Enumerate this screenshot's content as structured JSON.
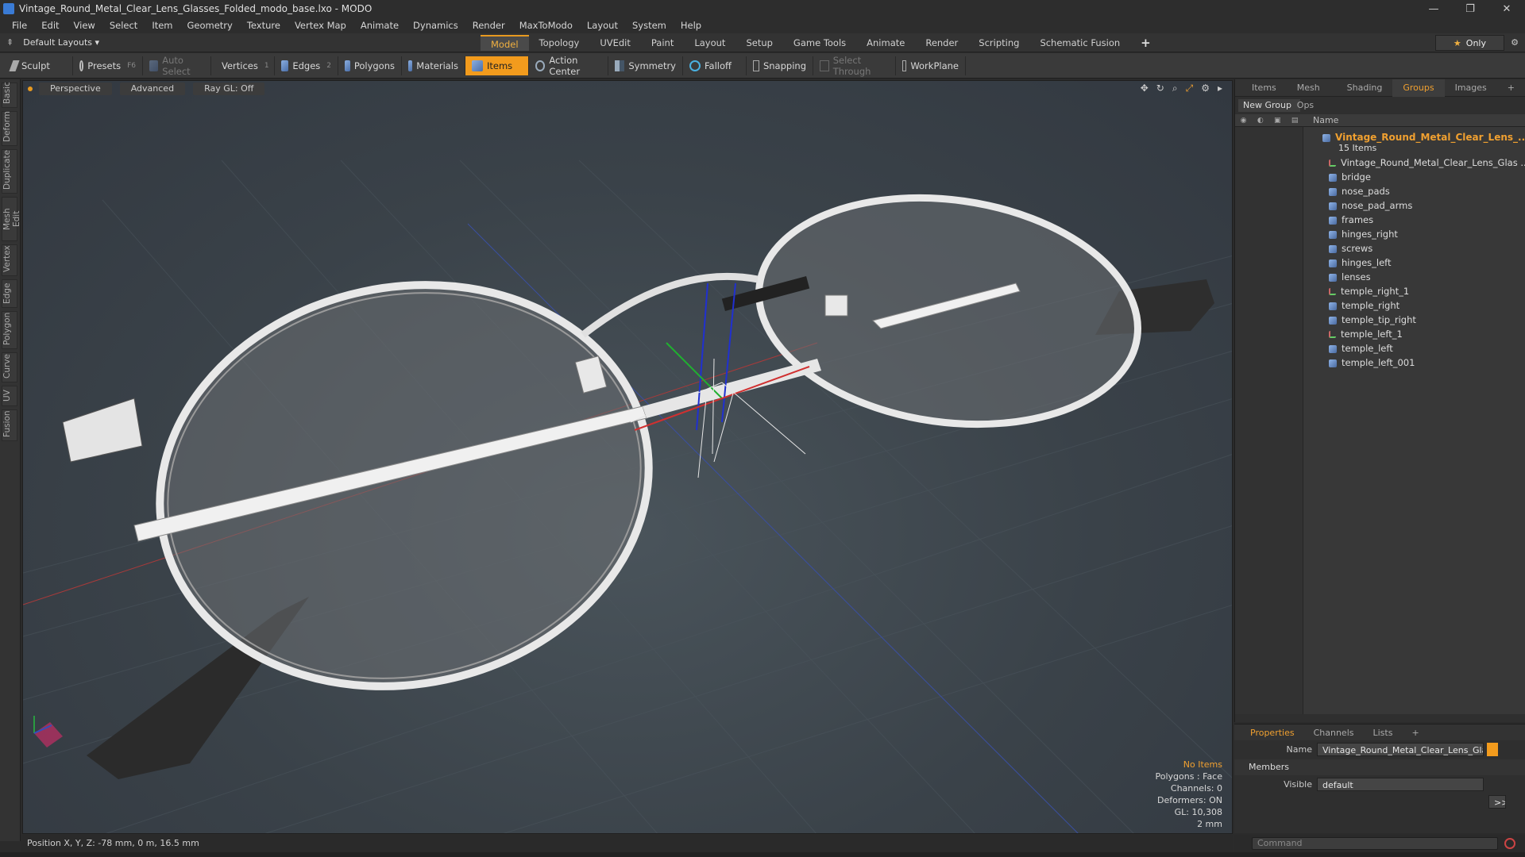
{
  "window": {
    "title": "Vintage_Round_Metal_Clear_Lens_Glasses_Folded_modo_base.lxo - MODO",
    "minimize": "—",
    "maximize": "❐",
    "close": "✕"
  },
  "menu": [
    "File",
    "Edit",
    "View",
    "Select",
    "Item",
    "Geometry",
    "Texture",
    "Vertex Map",
    "Animate",
    "Dynamics",
    "Render",
    "MaxToModo",
    "Layout",
    "System",
    "Help"
  ],
  "layouts": {
    "label": "Default Layouts ▾"
  },
  "mode_tabs": [
    {
      "label": "Model",
      "active": true
    },
    {
      "label": "Topology"
    },
    {
      "label": "UVEdit"
    },
    {
      "label": "Paint"
    },
    {
      "label": "Layout"
    },
    {
      "label": "Setup"
    },
    {
      "label": "Game Tools"
    },
    {
      "label": "Animate"
    },
    {
      "label": "Render"
    },
    {
      "label": "Scripting"
    },
    {
      "label": "Schematic Fusion"
    }
  ],
  "add_tab": "+",
  "only_label": "Only",
  "toolbar": {
    "sculpt": "Sculpt",
    "presets": "Presets",
    "presets_key": "F6",
    "auto_select": "Auto Select",
    "vertices": "Vertices",
    "vertices_key": "1",
    "edges": "Edges",
    "edges_key": "2",
    "polygons": "Polygons",
    "materials": "Materials",
    "items": "Items",
    "action_center": "Action Center",
    "symmetry": "Symmetry",
    "falloff": "Falloff",
    "snapping": "Snapping",
    "select_through": "Select Through",
    "workplane": "WorkPlane"
  },
  "left_rail": [
    "Basic",
    "Deform",
    "Duplicate",
    "Mesh Edit",
    "Vertex",
    "Edge",
    "Polygon",
    "Curve",
    "UV",
    "Fusion"
  ],
  "viewport": {
    "view": "Perspective",
    "shading": "Advanced",
    "raygl": "Ray GL: Off",
    "info": {
      "selection": "No Items",
      "polygons": "Polygons : Face",
      "channels": "Channels: 0",
      "deformers": "Deformers: ON",
      "gl": "GL: 10,308",
      "scale": "2 mm"
    }
  },
  "right_panel": {
    "tabs": [
      {
        "label": "Items"
      },
      {
        "label": "Mesh Ops"
      },
      {
        "label": "Shading"
      },
      {
        "label": "Groups",
        "active": true
      },
      {
        "label": "Images"
      }
    ],
    "add_tab": "+",
    "new_group": "New Group",
    "name_header": "Name",
    "root": "Vintage_Round_Metal_Clear_Lens_...",
    "root_count": "15 Items",
    "items": [
      {
        "name": "Vintage_Round_Metal_Clear_Lens_Glas ...",
        "type": "locator"
      },
      {
        "name": "bridge",
        "type": "mesh"
      },
      {
        "name": "nose_pads",
        "type": "mesh"
      },
      {
        "name": "nose_pad_arms",
        "type": "mesh"
      },
      {
        "name": "frames",
        "type": "mesh"
      },
      {
        "name": "hinges_right",
        "type": "mesh"
      },
      {
        "name": "screws",
        "type": "mesh"
      },
      {
        "name": "hinges_left",
        "type": "mesh"
      },
      {
        "name": "lenses",
        "type": "mesh"
      },
      {
        "name": "temple_right_1",
        "type": "locator"
      },
      {
        "name": "temple_right",
        "type": "mesh"
      },
      {
        "name": "temple_tip_right",
        "type": "mesh"
      },
      {
        "name": "temple_left_1",
        "type": "locator"
      },
      {
        "name": "temple_left",
        "type": "mesh"
      },
      {
        "name": "temple_left_001",
        "type": "mesh"
      }
    ]
  },
  "properties": {
    "tabs": [
      {
        "label": "Properties",
        "active": true
      },
      {
        "label": "Channels"
      },
      {
        "label": "Lists"
      }
    ],
    "add_tab": "+",
    "name_label": "Name",
    "name_value": "Vintage_Round_Metal_Clear_Lens_Glass",
    "members_label": "Members",
    "visible_label": "Visible",
    "visible_value": "default",
    "expand_btn": ">>"
  },
  "status": {
    "position": "Position X, Y, Z:  -78 mm, 0 m, 16.5 mm"
  },
  "command": {
    "placeholder": "Command"
  },
  "colors": {
    "accent": "#f29b1d",
    "background": "#2b2b2b"
  }
}
